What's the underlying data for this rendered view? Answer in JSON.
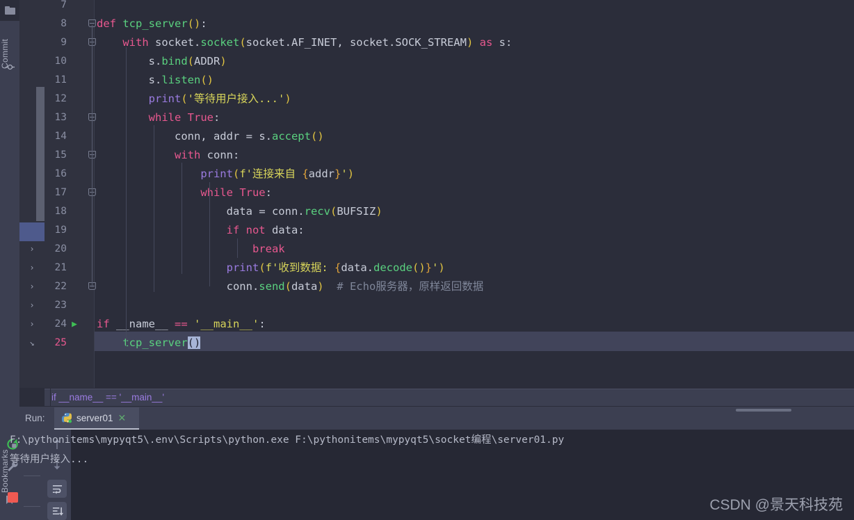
{
  "rail": {
    "top_button_icon": "folder-icon",
    "commit_label": "Commit",
    "commit_icon": "commit-icon",
    "bookmarks_label": "Bookmarks",
    "bookmarks_icon": "bookmark-icon"
  },
  "editor": {
    "first_visible_line": 7,
    "current_line": 25,
    "breadcrumb": "if __name__ == '__main__'",
    "lines": [
      {
        "n": 7,
        "tokens": []
      },
      {
        "n": 8,
        "fold": true,
        "tokens": [
          {
            "t": "def ",
            "c": "kw"
          },
          {
            "t": "tcp_server",
            "c": "fn"
          },
          {
            "t": "()",
            "c": "punc"
          },
          {
            "t": ":",
            "c": "op"
          }
        ]
      },
      {
        "n": 9,
        "fold": true,
        "tokens": [
          {
            "t": "    ",
            "c": "op"
          },
          {
            "t": "with ",
            "c": "kw"
          },
          {
            "t": "socket.",
            "c": "var"
          },
          {
            "t": "socket",
            "c": "fn"
          },
          {
            "t": "(",
            "c": "punc"
          },
          {
            "t": "socket.AF_INET, socket.SOCK_STREAM",
            "c": "var"
          },
          {
            "t": ")",
            "c": "punc"
          },
          {
            "t": " ",
            "c": "op"
          },
          {
            "t": "as ",
            "c": "kw"
          },
          {
            "t": "s",
            "c": "var"
          },
          {
            "t": ":",
            "c": "op"
          }
        ]
      },
      {
        "n": 10,
        "tokens": [
          {
            "t": "        s.",
            "c": "var"
          },
          {
            "t": "bind",
            "c": "fn"
          },
          {
            "t": "(",
            "c": "punc"
          },
          {
            "t": "ADDR",
            "c": "var"
          },
          {
            "t": ")",
            "c": "punc"
          }
        ]
      },
      {
        "n": 11,
        "tokens": [
          {
            "t": "        s.",
            "c": "var"
          },
          {
            "t": "listen",
            "c": "fn"
          },
          {
            "t": "()",
            "c": "punc"
          }
        ]
      },
      {
        "n": 12,
        "tokens": [
          {
            "t": "        ",
            "c": "op"
          },
          {
            "t": "print",
            "c": "call"
          },
          {
            "t": "(",
            "c": "punc"
          },
          {
            "t": "'等待用户接入...'",
            "c": "str"
          },
          {
            "t": ")",
            "c": "punc"
          }
        ]
      },
      {
        "n": 13,
        "fold": true,
        "tokens": [
          {
            "t": "        ",
            "c": "op"
          },
          {
            "t": "while ",
            "c": "kw"
          },
          {
            "t": "True",
            "c": "kw"
          },
          {
            "t": ":",
            "c": "op"
          }
        ]
      },
      {
        "n": 14,
        "tokens": [
          {
            "t": "            conn, addr ",
            "c": "var"
          },
          {
            "t": "= ",
            "c": "op"
          },
          {
            "t": "s.",
            "c": "var"
          },
          {
            "t": "accept",
            "c": "fn"
          },
          {
            "t": "()",
            "c": "punc"
          }
        ]
      },
      {
        "n": 15,
        "fold": true,
        "tokens": [
          {
            "t": "            ",
            "c": "op"
          },
          {
            "t": "with ",
            "c": "kw"
          },
          {
            "t": "conn",
            "c": "var"
          },
          {
            "t": ":",
            "c": "op"
          }
        ]
      },
      {
        "n": 16,
        "tokens": [
          {
            "t": "                ",
            "c": "op"
          },
          {
            "t": "print",
            "c": "call"
          },
          {
            "t": "(",
            "c": "punc"
          },
          {
            "t": "f'连接来自 ",
            "c": "str"
          },
          {
            "t": "{",
            "c": "fbrc"
          },
          {
            "t": "addr",
            "c": "var"
          },
          {
            "t": "}",
            "c": "fbrc"
          },
          {
            "t": "'",
            "c": "str"
          },
          {
            "t": ")",
            "c": "punc"
          }
        ]
      },
      {
        "n": 17,
        "fold": true,
        "tokens": [
          {
            "t": "                ",
            "c": "op"
          },
          {
            "t": "while ",
            "c": "kw"
          },
          {
            "t": "True",
            "c": "kw"
          },
          {
            "t": ":",
            "c": "op"
          }
        ]
      },
      {
        "n": 18,
        "tokens": [
          {
            "t": "                    data ",
            "c": "var"
          },
          {
            "t": "= ",
            "c": "op"
          },
          {
            "t": "conn.",
            "c": "var"
          },
          {
            "t": "recv",
            "c": "fn"
          },
          {
            "t": "(",
            "c": "punc"
          },
          {
            "t": "BUFSIZ",
            "c": "var"
          },
          {
            "t": ")",
            "c": "punc"
          }
        ]
      },
      {
        "n": 19,
        "tokens": [
          {
            "t": "                    ",
            "c": "op"
          },
          {
            "t": "if ",
            "c": "kw"
          },
          {
            "t": "not ",
            "c": "kw"
          },
          {
            "t": "data",
            "c": "var"
          },
          {
            "t": ":",
            "c": "op"
          }
        ]
      },
      {
        "n": 20,
        "vcs": true,
        "tokens": [
          {
            "t": "                        ",
            "c": "op"
          },
          {
            "t": "break",
            "c": "kw"
          }
        ]
      },
      {
        "n": 21,
        "vcs": true,
        "tokens": [
          {
            "t": "                    ",
            "c": "op"
          },
          {
            "t": "print",
            "c": "call"
          },
          {
            "t": "(",
            "c": "punc"
          },
          {
            "t": "f'收到数据: ",
            "c": "str"
          },
          {
            "t": "{",
            "c": "fbrc"
          },
          {
            "t": "data.",
            "c": "var"
          },
          {
            "t": "decode",
            "c": "fn"
          },
          {
            "t": "()",
            "c": "punc"
          },
          {
            "t": "}",
            "c": "fbrc"
          },
          {
            "t": "'",
            "c": "str"
          },
          {
            "t": ")",
            "c": "punc"
          }
        ]
      },
      {
        "n": 22,
        "vcs": true,
        "fold": true,
        "tokens": [
          {
            "t": "                    conn.",
            "c": "var"
          },
          {
            "t": "send",
            "c": "fn"
          },
          {
            "t": "(",
            "c": "punc"
          },
          {
            "t": "data",
            "c": "var"
          },
          {
            "t": ")",
            "c": "punc"
          },
          {
            "t": "  # Echo服务器，原样返回数据",
            "c": "cmt"
          }
        ]
      },
      {
        "n": 23,
        "vcs": true,
        "tokens": []
      },
      {
        "n": 24,
        "vcs": true,
        "run": true,
        "tokens": [
          {
            "t": "",
            "c": "op"
          },
          {
            "t": "if ",
            "c": "kw"
          },
          {
            "t": "__name__ ",
            "c": "var"
          },
          {
            "t": "== ",
            "c": "kw"
          },
          {
            "t": "'__main__'",
            "c": "str"
          },
          {
            "t": ":",
            "c": "op"
          }
        ]
      },
      {
        "n": 25,
        "vcs_end": true,
        "current": true,
        "tokens": [
          {
            "t": "    ",
            "c": "op"
          },
          {
            "t": "tcp_server",
            "c": "fn"
          },
          {
            "t": "()",
            "c": "sel"
          }
        ]
      }
    ]
  },
  "run_tool_window": {
    "label": "Run:",
    "tab": {
      "name": "server01",
      "icon": "python-icon",
      "close_icon": "close-icon",
      "running": true
    },
    "toolbar": [
      {
        "name": "rerun-button",
        "icon": "rerun-icon"
      },
      {
        "name": "settings-button",
        "icon": "wrench-icon"
      },
      {
        "name": "stop-button",
        "icon": "stop-icon"
      }
    ],
    "toolbar_right": [
      {
        "name": "scroll-up-button",
        "icon": "arrow-up-icon"
      },
      {
        "name": "scroll-down-button",
        "icon": "arrow-down-icon"
      },
      {
        "name": "soft-wrap-button",
        "icon": "soft-wrap-icon"
      },
      {
        "name": "scroll-to-end-button",
        "icon": "scroll-to-end-icon"
      }
    ],
    "console_lines": [
      "F:\\pythonitems\\mypyqt5\\.env\\Scripts\\python.exe F:\\pythonitems\\mypyqt5\\socket编程\\server01.py",
      "等待用户接入..."
    ]
  },
  "watermark": "CSDN @景天科技苑",
  "colors": {
    "editor_bg": "#2b2d3a",
    "gutter_bg": "#30323f",
    "panel_bg": "#3c3f51",
    "console_bg": "#262834",
    "current_line": "#41445a",
    "keyword": "#e8588f",
    "function": "#5ad17f",
    "string": "#d7d45a",
    "comment": "#7f8699",
    "accent_green": "#3fbf55",
    "stop_red": "#f05a52",
    "selection": "#a7b4d6"
  }
}
